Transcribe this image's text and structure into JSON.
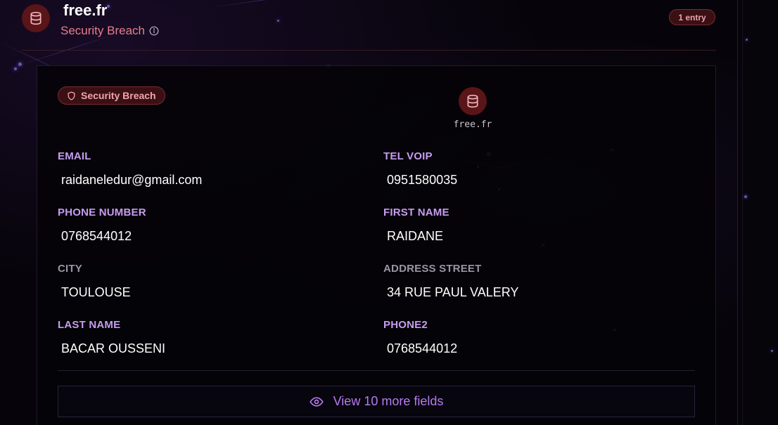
{
  "header": {
    "title": "free.fr",
    "subtitle": "Security Breach",
    "entry_badge": "1 entry"
  },
  "card": {
    "tag_label": "Security Breach",
    "source_label": "free.fr",
    "fields": [
      {
        "label": "EMAIL",
        "value": "raidaneledur@gmail.com"
      },
      {
        "label": "TEL VOIP",
        "value": "0951580035"
      },
      {
        "label": "PHONE NUMBER",
        "value": "0768544012"
      },
      {
        "label": "FIRST NAME",
        "value": "RAIDANE"
      },
      {
        "label": "CITY",
        "value": "TOULOUSE"
      },
      {
        "label": "ADDRESS STREET",
        "value": "34 RUE PAUL VALERY"
      },
      {
        "label": "LAST NAME",
        "value": "BACAR OUSSENI"
      },
      {
        "label": "PHONE2",
        "value": "0768544012"
      }
    ],
    "more_button": "View 10 more fields"
  },
  "icons": {
    "header_icon": "database-icon",
    "info_icon": "info-icon",
    "tag_icon": "shield-icon",
    "source_icon": "database-icon",
    "more_icon": "eye-icon"
  },
  "colors": {
    "accent_purple": "#c79cf0",
    "breach_red": "#e87f8a",
    "icon_bg": "#5a1519",
    "background": "#06040a"
  }
}
